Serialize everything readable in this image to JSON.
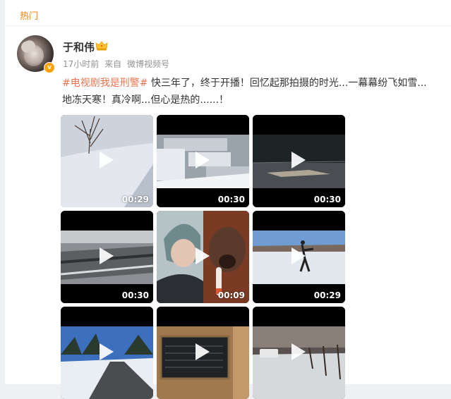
{
  "header": {
    "tab_label": "热门"
  },
  "post": {
    "username": "于和伟",
    "time": "17小时前",
    "source_prefix": "来自",
    "source": "微博视频号",
    "badge": "v",
    "hashtag": "#电视剧我是刑警#",
    "body": "快三年了，终于开播！回忆起那拍摄的时光...一幕幕纷飞如雪...地冻天寒！真冷啊...但心是热的......！"
  },
  "videos": [
    {
      "duration": "00:29",
      "scene": "snow-tree"
    },
    {
      "duration": "00:30",
      "scene": "snowy-buildings"
    },
    {
      "duration": "00:30",
      "scene": "night-shore"
    },
    {
      "duration": "00:30",
      "scene": "train-snow"
    },
    {
      "duration": "00:09",
      "scene": "man-and-dog"
    },
    {
      "duration": "00:29",
      "scene": "snow-field-person"
    },
    {
      "duration": "",
      "scene": "snowy-road"
    },
    {
      "duration": "",
      "scene": "old-stone-plaque"
    },
    {
      "duration": "",
      "scene": "snow-street-car"
    }
  ],
  "colors": {
    "hashtag": "#eb7350",
    "hot": "#ff8200",
    "meta": "#939393",
    "badge": "#ffa100"
  }
}
